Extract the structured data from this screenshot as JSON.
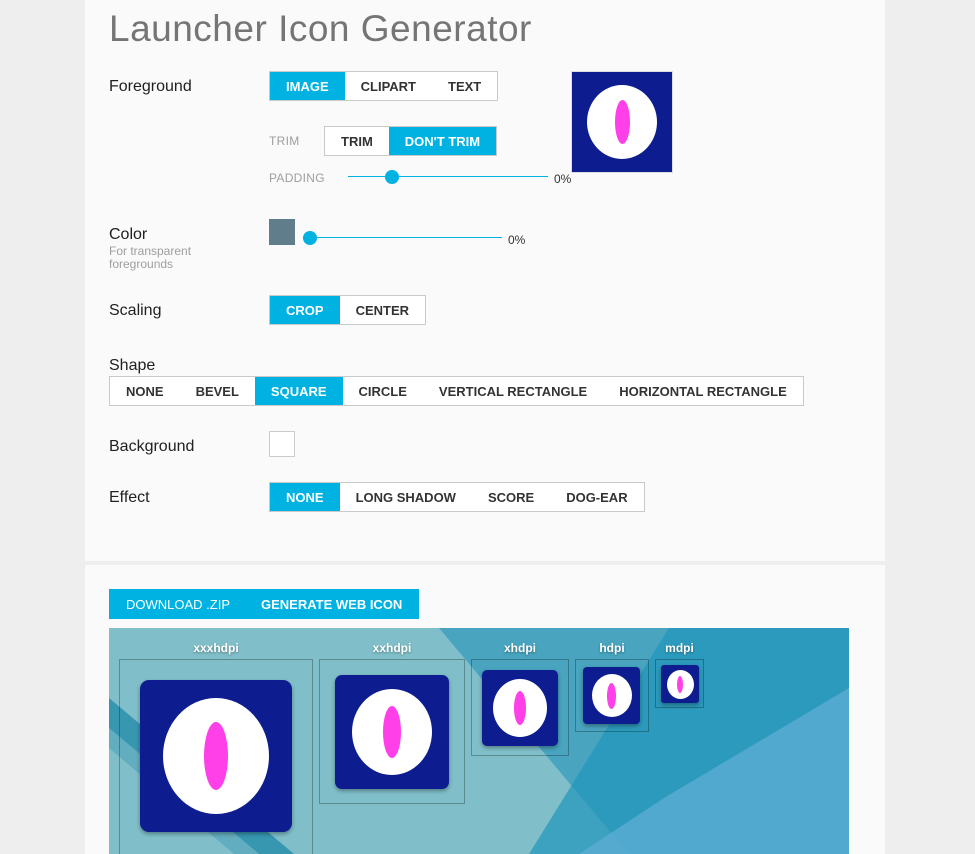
{
  "page": {
    "title": "Launcher Icon Generator"
  },
  "foreground": {
    "label": "Foreground",
    "tabs": [
      {
        "label": "IMAGE",
        "active": true
      },
      {
        "label": "CLIPART",
        "active": false
      },
      {
        "label": "TEXT",
        "active": false
      }
    ],
    "trim": {
      "label": "TRIM",
      "options": [
        {
          "label": "TRIM",
          "active": false
        },
        {
          "label": "DON'T TRIM",
          "active": true
        }
      ]
    },
    "padding": {
      "label": "PADDING",
      "value_text": "0%",
      "value": 0.2
    }
  },
  "color": {
    "label": "Color",
    "sublabel": "For transparent foregrounds",
    "swatch": "#607d8b",
    "value_text": "0%",
    "value": 0
  },
  "scaling": {
    "label": "Scaling",
    "options": [
      {
        "label": "CROP",
        "active": true
      },
      {
        "label": "CENTER",
        "active": false
      }
    ]
  },
  "shape": {
    "label": "Shape",
    "options": [
      {
        "label": "NONE",
        "active": false
      },
      {
        "label": "BEVEL",
        "active": false
      },
      {
        "label": "SQUARE",
        "active": true
      },
      {
        "label": "CIRCLE",
        "active": false
      },
      {
        "label": "VERTICAL RECTANGLE",
        "active": false
      },
      {
        "label": "HORIZONTAL RECTANGLE",
        "active": false
      }
    ]
  },
  "background": {
    "label": "Background",
    "swatch": "#ffffff"
  },
  "effect": {
    "label": "Effect",
    "options": [
      {
        "label": "NONE",
        "active": true
      },
      {
        "label": "LONG SHADOW",
        "active": false
      },
      {
        "label": "SCORE",
        "active": false
      },
      {
        "label": "DOG-EAR",
        "active": false
      }
    ]
  },
  "actions": {
    "download": "DOWNLOAD .ZIP",
    "generate": "GENERATE WEB ICON"
  },
  "densities": [
    "xxxhdpi",
    "xxhdpi",
    "xhdpi",
    "hdpi",
    "mdpi"
  ],
  "colors": {
    "accent": "#00b2e1",
    "icon_bg": "#0d1d8f",
    "icon_inner": "#ff3fe8",
    "preview_bg": "#7fbec8"
  }
}
